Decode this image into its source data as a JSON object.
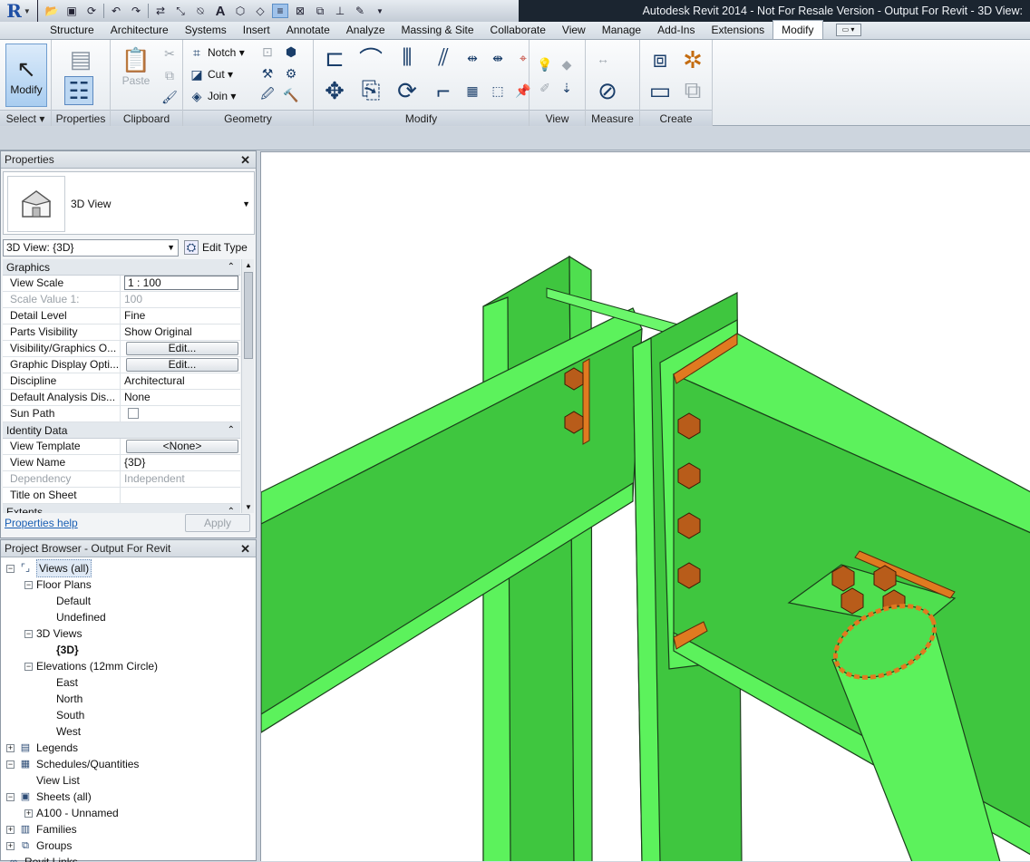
{
  "titlebar": {
    "title": "Autodesk Revit 2014 -  Not For Resale Version -    Output For Revit - 3D View:"
  },
  "qat": {
    "icons": [
      "open-icon",
      "save-icon",
      "sync-icon",
      "undo-icon",
      "redo-icon",
      "align-icon",
      "measure-icon",
      "tag-icon",
      "text-icon",
      "3d-view-icon",
      "section-icon",
      "thin-lines-icon",
      "close-hidden-icon",
      "switch-windows-icon",
      "align-dim-icon",
      "modify-icon",
      "dropdown-icon"
    ]
  },
  "tabs": [
    "Structure",
    "Architecture",
    "Systems",
    "Insert",
    "Annotate",
    "Analyze",
    "Massing & Site",
    "Collaborate",
    "View",
    "Manage",
    "Add-Ins",
    "Extensions",
    "Modify"
  ],
  "active_tab": "Modify",
  "ribbon": {
    "select": {
      "modify_label": "Modify",
      "panel_label": "Select ▾"
    },
    "properties": {
      "panel_label": "Properties"
    },
    "clipboard": {
      "paste_label": "Paste",
      "panel_label": "Clipboard"
    },
    "geometry": {
      "notch_label": "Notch",
      "cut_label": "Cut",
      "join_label": "Join",
      "panel_label": "Geometry"
    },
    "modify": {
      "panel_label": "Modify"
    },
    "view": {
      "panel_label": "View"
    },
    "measure": {
      "panel_label": "Measure"
    },
    "create": {
      "panel_label": "Create"
    }
  },
  "properties": {
    "header": "Properties",
    "type_name": "3D View",
    "instance_selector": "3D View: {3D}",
    "edit_type_label": "Edit Type",
    "groups": [
      {
        "name": "Graphics",
        "rows": [
          {
            "key": "View Scale",
            "value": "1 : 100",
            "kind": "input"
          },
          {
            "key": "Scale Value    1:",
            "value": "100",
            "kind": "dim"
          },
          {
            "key": "Detail Level",
            "value": "Fine",
            "kind": "text"
          },
          {
            "key": "Parts Visibility",
            "value": "Show Original",
            "kind": "text"
          },
          {
            "key": "Visibility/Graphics O...",
            "value": "Edit...",
            "kind": "button"
          },
          {
            "key": "Graphic Display Opti...",
            "value": "Edit...",
            "kind": "button"
          },
          {
            "key": "Discipline",
            "value": "Architectural",
            "kind": "text"
          },
          {
            "key": "Default Analysis Dis...",
            "value": "None",
            "kind": "text"
          },
          {
            "key": "Sun Path",
            "value": "",
            "kind": "checkbox"
          }
        ]
      },
      {
        "name": "Identity Data",
        "rows": [
          {
            "key": "View Template",
            "value": "<None>",
            "kind": "button"
          },
          {
            "key": "View Name",
            "value": "{3D}",
            "kind": "text"
          },
          {
            "key": "Dependency",
            "value": "Independent",
            "kind": "dim"
          },
          {
            "key": "Title on Sheet",
            "value": "",
            "kind": "text"
          }
        ]
      },
      {
        "name": "Extents",
        "rows": []
      }
    ],
    "help_link": "Properties help",
    "apply_label": "Apply"
  },
  "browser": {
    "header": "Project Browser - Output For Revit",
    "nodes": [
      {
        "label": "Views (all)",
        "level": 0,
        "toggle": "-",
        "icon": "views-icon",
        "selected": true
      },
      {
        "label": "Floor Plans",
        "level": 1,
        "toggle": "-"
      },
      {
        "label": "Default",
        "level": 2
      },
      {
        "label": "Undefined",
        "level": 2
      },
      {
        "label": "3D Views",
        "level": 1,
        "toggle": "-"
      },
      {
        "label": "{3D}",
        "level": 2,
        "bold": true
      },
      {
        "label": "Elevations (12mm Circle)",
        "level": 1,
        "toggle": "-"
      },
      {
        "label": "East",
        "level": 2
      },
      {
        "label": "North",
        "level": 2
      },
      {
        "label": "South",
        "level": 2
      },
      {
        "label": "West",
        "level": 2
      },
      {
        "label": "Legends",
        "level": 0,
        "toggle": "+",
        "icon": "legends-icon"
      },
      {
        "label": "Schedules/Quantities",
        "level": 0,
        "toggle": "-",
        "icon": "schedules-icon"
      },
      {
        "label": "View List",
        "level": 1
      },
      {
        "label": "Sheets (all)",
        "level": 0,
        "toggle": "-",
        "icon": "sheets-icon"
      },
      {
        "label": "A100 - Unnamed",
        "level": 1,
        "toggle": "+"
      },
      {
        "label": "Families",
        "level": 0,
        "toggle": "+",
        "icon": "families-icon"
      },
      {
        "label": "Groups",
        "level": 0,
        "toggle": "+",
        "icon": "groups-icon"
      },
      {
        "label": "Revit Links",
        "level": 0,
        "icon": "links-icon"
      }
    ]
  },
  "colors": {
    "steel": "#5cf25c",
    "steel_dark": "#2e8a2e",
    "bolt": "#b85c1a",
    "plate_edge": "#e07a20"
  }
}
